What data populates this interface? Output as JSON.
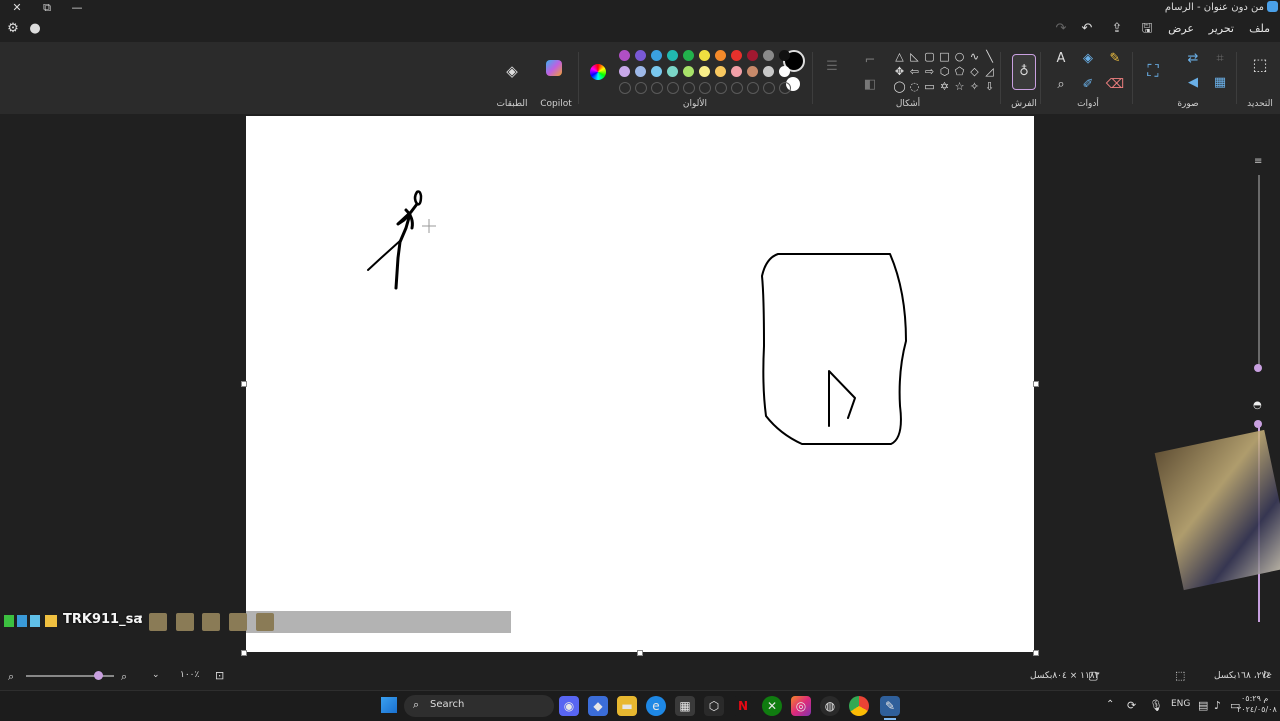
{
  "window": {
    "title": "من دون عنوان - الرسام",
    "minimize_glyph": "—",
    "restore_glyph": "⧉",
    "close_glyph": "✕"
  },
  "menu": {
    "file": "ملف",
    "edit": "تحرير",
    "view": "عرض"
  },
  "ribbon": {
    "selection_label": "التحديد",
    "image_label": "صورة",
    "tools_label": "أدوات",
    "brushes_label": "الفرش",
    "shapes_label": "أشكال",
    "colors_label": "الألوان",
    "copilot_label": "Copilot",
    "layers_label": "الطبقات"
  },
  "palette": {
    "row1": [
      "#b04fc4",
      "#7a59d6",
      "#3aa0e0",
      "#21b9b0",
      "#22b14c",
      "#f0e040",
      "#f58a2a",
      "#e8312c",
      "#a01830",
      "#8a8a8a",
      "#111111"
    ],
    "row2": [
      "#c8a8e8",
      "#9db8e8",
      "#7ac8ee",
      "#7bd6c8",
      "#a8e26a",
      "#f8ee8a",
      "#f8c860",
      "#f2a0a8",
      "#c88a6a",
      "#c8c8c8",
      "#ffffff"
    ],
    "primary": "#000000",
    "secondary": "#ffffff"
  },
  "chat": {
    "username": "TRK911_sa",
    "separator": ":"
  },
  "status": {
    "zoom": "١٠٠٪",
    "canvas_size": "١١٨٣ × ٨٠٤بكسل",
    "cursor_pos": "٢٧٤، ١٦٨بكسل"
  },
  "taskbar": {
    "search": "Search",
    "lang": "ENG",
    "time": "م ٠٥:٢٩",
    "date": "٢٠٢٤/٠٥/٠٨"
  },
  "colors": {
    "accent": "#c9a0e0"
  }
}
